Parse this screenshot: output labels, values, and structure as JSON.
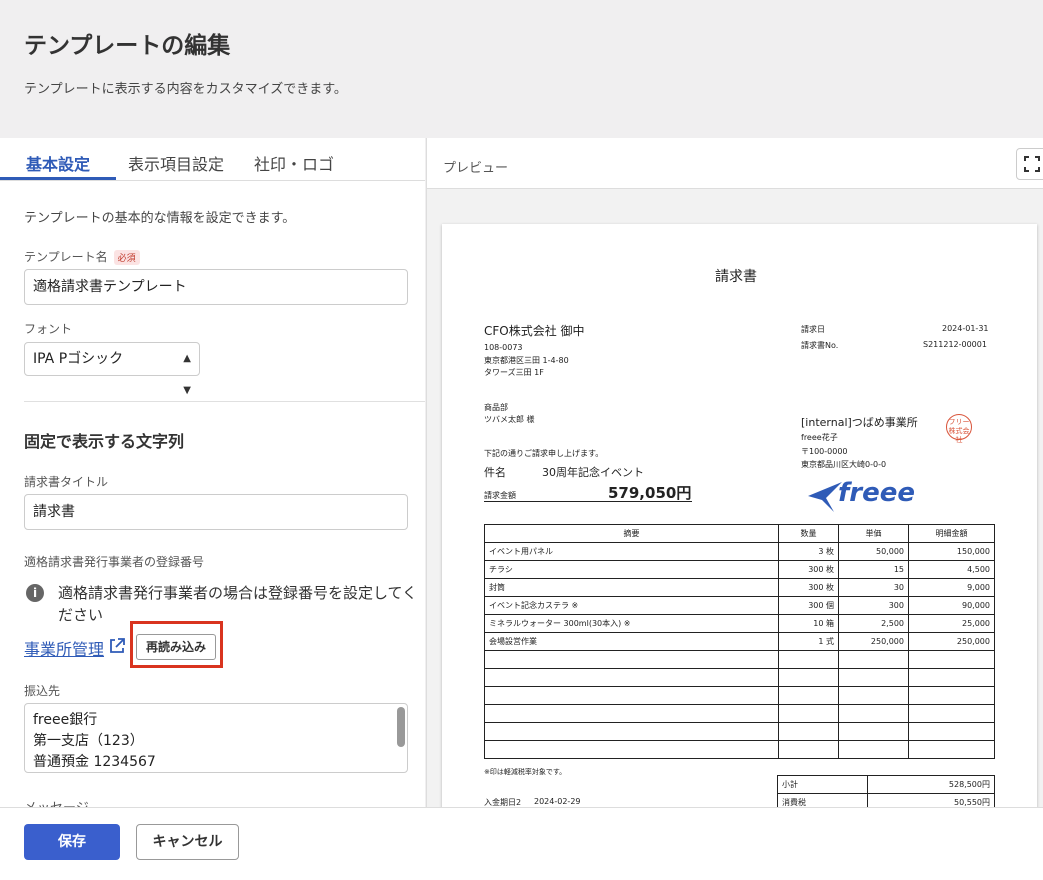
{
  "header": {
    "title": "テンプレートの編集",
    "subtitle": "テンプレートに表示する内容をカスタマイズできます。"
  },
  "tabs": [
    "基本設定",
    "表示項目設定",
    "社印・ロゴ"
  ],
  "basic": {
    "description": "テンプレートの基本的な情報を設定できます。",
    "template_name_label": "テンプレート名",
    "required_badge": "必須",
    "template_name_value": "適格請求書テンプレート",
    "font_label": "フォント",
    "font_value": "IPA Pゴシック",
    "fixed_section_title": "固定で表示する文字列",
    "invoice_title_label": "請求書タイトル",
    "invoice_title_value": "請求書",
    "registration_label": "適格請求書発行事業者の登録番号",
    "registration_info": "適格請求書発行事業者の場合は登録番号を設定してください",
    "office_link": "事業所管理",
    "reload_button": "再読み込み",
    "transfer_label": "振込先",
    "transfer_lines": [
      "freee銀行",
      "第一支店（123）",
      "普通預金 1234567"
    ],
    "message_label": "メッセージ"
  },
  "footer": {
    "save_label": "保存",
    "cancel_label": "キャンセル"
  },
  "preview": {
    "title": "プレビュー",
    "doc_title": "請求書",
    "client_name": "CFO株式会社 御中",
    "client_postal": "108-0073",
    "client_address1": "東京都港区三田 1-4-80",
    "client_address2": "タワーズ三田 1F",
    "issue_date_label": "請求日",
    "issue_date": "2024-01-31",
    "invoice_no_label": "請求書No.",
    "invoice_no": "S211212-00001",
    "dept": "商品部",
    "contact": "ツバメ太郎 様",
    "sender_name": "[internal]つばめ事業所",
    "sender_person": "freee花子",
    "sender_postal": "〒100-0000",
    "sender_address": "東京都品川区大崎0-0-0",
    "stamp_text": "フリー 株式会社",
    "logo_text": "freee",
    "intro_text": "下記の通りご請求申し上げます。",
    "subject_label": "件名",
    "subject_value": "30周年記念イベント",
    "amount_label": "請求金額",
    "amount_value": "579,050円",
    "table_headers": [
      "摘要",
      "数量",
      "単価",
      "明細金額"
    ],
    "table_rows": [
      [
        "イベント用パネル",
        "3 枚",
        "50,000",
        "150,000"
      ],
      [
        "チラシ",
        "300 枚",
        "15",
        "4,500"
      ],
      [
        "封筒",
        "300 枚",
        "30",
        "9,000"
      ],
      [
        "イベント記念カステラ ※",
        "300 個",
        "300",
        "90,000"
      ],
      [
        "ミネラルウォーター 300ml(30本入) ※",
        "10 箱",
        "2,500",
        "25,000"
      ],
      [
        "会場設営作業",
        "1 式",
        "250,000",
        "250,000"
      ],
      [
        "",
        "",
        "",
        ""
      ],
      [
        "",
        "",
        "",
        ""
      ],
      [
        "",
        "",
        "",
        ""
      ],
      [
        "",
        "",
        "",
        ""
      ],
      [
        "",
        "",
        "",
        ""
      ],
      [
        "",
        "",
        "",
        ""
      ]
    ],
    "note": "※印は軽減税率対象です。",
    "subtotal_label": "小計",
    "subtotal_value": "528,500円",
    "tax_label": "消費税",
    "tax_value": "50,550円",
    "due_label": "入金期日2",
    "due_date": "2024-02-29",
    "brand_color": "#2f5bb7"
  }
}
